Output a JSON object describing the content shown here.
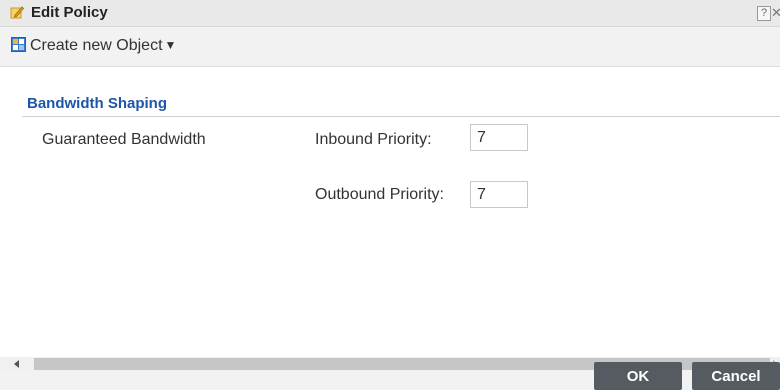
{
  "window": {
    "title": "Edit Policy",
    "help_glyph": "?",
    "close_glyph": "✕"
  },
  "toolbar": {
    "create_label": "Create new Object",
    "caret": "▼"
  },
  "section": {
    "title": "Bandwidth Shaping"
  },
  "form": {
    "guaranteed_label": "Guaranteed Bandwidth",
    "inbound_label": "Inbound Priority:",
    "inbound_value": "7",
    "outbound_label": "Outbound Priority:",
    "outbound_value": "7"
  },
  "buttons": {
    "ok": "OK",
    "cancel": "Cancel"
  },
  "colors": {
    "section_title": "#1f55a8",
    "button_bg": "#555b60",
    "edit_icon": "#f0b429"
  },
  "icons": {
    "title": "edit-pencil-icon",
    "create": "object-grid-icon"
  }
}
